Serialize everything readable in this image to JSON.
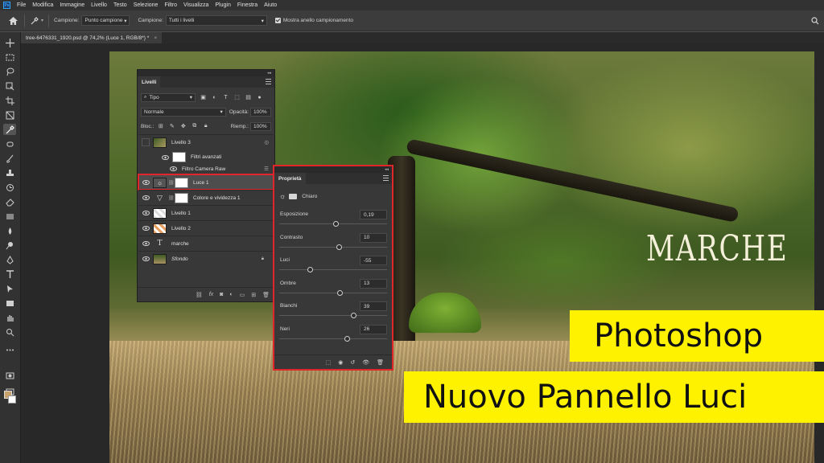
{
  "menubar": {
    "logo": "Ps",
    "items": [
      "File",
      "Modifica",
      "Immagine",
      "Livello",
      "Testo",
      "Selezione",
      "Filtro",
      "Visualizza",
      "Plugin",
      "Finestra",
      "Aiuto"
    ]
  },
  "options_bar": {
    "sample_label": "Campione:",
    "sample_value": "Punto campione",
    "sample2_label": "Campione:",
    "sample2_value": "Tutti i livelli",
    "ring_label": "Mostra anello campionamento"
  },
  "document_tab": {
    "title": "tree-6476331_1920.psd @ 74,2% (Luce 1, RGB/8*) *",
    "close": "×"
  },
  "layers_panel": {
    "tab": "Livelli",
    "filter_value": "Tipo",
    "blend_mode": "Normale",
    "opacity_label": "Opacità:",
    "opacity_value": "100%",
    "lock_label": "Bloc.:",
    "fill_label": "Riemp.:",
    "fill_value": "100%",
    "layers": [
      {
        "name": "Livello 3"
      },
      {
        "name": "Filtri avanzati"
      },
      {
        "name": "Filtro Camera Raw"
      },
      {
        "name": "Luce 1",
        "selected": true
      },
      {
        "name": "Colore e vividezza 1"
      },
      {
        "name": "Livello 1"
      },
      {
        "name": "Livello 2"
      },
      {
        "name": "marche"
      },
      {
        "name": "Sfondo"
      }
    ]
  },
  "properties_panel": {
    "tab": "Proprietà",
    "preset": "Chiaro",
    "sliders": [
      {
        "label": "Esposizione",
        "value": "0,19",
        "position": 0.52
      },
      {
        "label": "Contrasto",
        "value": "10",
        "position": 0.55
      },
      {
        "label": "Luci",
        "value": "-55",
        "position": 0.28
      },
      {
        "label": "Ombre",
        "value": "13",
        "position": 0.56
      },
      {
        "label": "Bianchi",
        "value": "39",
        "position": 0.69
      },
      {
        "label": "Neri",
        "value": "26",
        "position": 0.63
      }
    ]
  },
  "canvas": {
    "image_text": "MARCHE",
    "banner_1": "Photoshop",
    "banner_2": "Nuovo Pannello Luci"
  },
  "colors": {
    "banner": "#fff200",
    "highlight": "#e0262b",
    "foreground": "#c8a06a",
    "background": "#ffffff"
  }
}
